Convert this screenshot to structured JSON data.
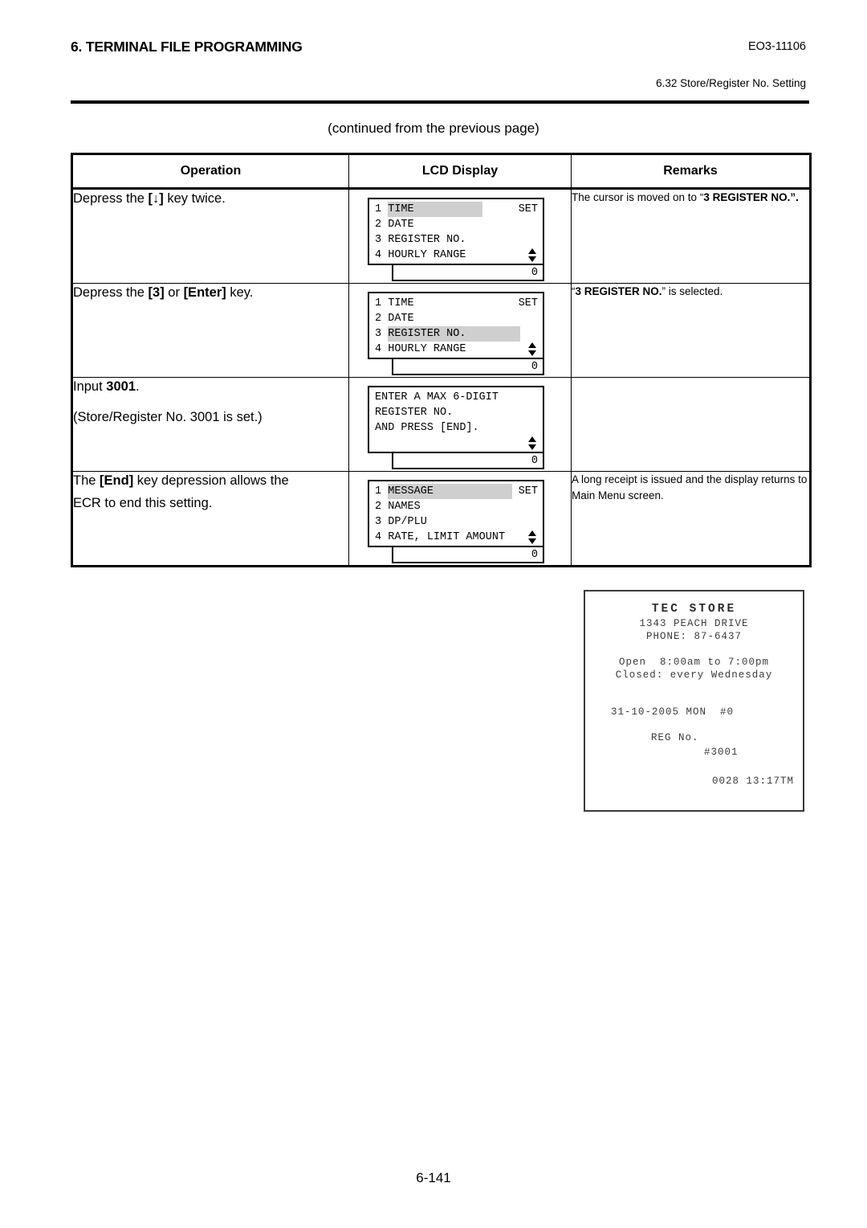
{
  "header": {
    "doc_title": "6. TERMINAL FILE PROGRAMMING",
    "doc_code": "EO3-11106",
    "section_ref": "6.32 Store/Register No. Setting"
  },
  "continued_note": "(continued from the previous page)",
  "table": {
    "columns": [
      "Operation",
      "LCD Display",
      "Remarks"
    ],
    "rows": [
      {
        "operation": {
          "prefix": "Depress the ",
          "key": "[↓]",
          "suffix": " key twice.",
          "line2": ""
        },
        "lcd": {
          "lines": [
            {
              "index": "1",
              "text": "TIME",
              "highlight": true,
              "hl_width": 118
            },
            {
              "index": "2",
              "text": "DATE",
              "highlight": false
            },
            {
              "index": "3",
              "text": "REGISTER NO.",
              "highlight": false
            },
            {
              "index": "4",
              "text": "HOURLY RANGE",
              "highlight": false
            }
          ],
          "set_label": "SET",
          "value": "0"
        },
        "remarks_plain_1": "The cursor is moved on to “",
        "remarks_bold": "3 REGISTER NO.",
        "remarks_plain_2": "”."
      },
      {
        "operation": {
          "prefix": "Depress the ",
          "key": "[3]",
          "middle": " or ",
          "key2": "[Enter]",
          "suffix": " key.",
          "line2": ""
        },
        "lcd": {
          "lines": [
            {
              "index": "1",
              "text": "TIME",
              "highlight": false
            },
            {
              "index": "2",
              "text": "DATE",
              "highlight": false
            },
            {
              "index": "3",
              "text": "REGISTER NO.",
              "highlight": true,
              "hl_width": 165
            },
            {
              "index": "4",
              "text": "HOURLY RANGE",
              "highlight": false
            }
          ],
          "set_label": "SET",
          "value": "0"
        },
        "remarks_plain_1": "“",
        "remarks_bold": "3 REGISTER NO.",
        "remarks_plain_2": "” is selected."
      },
      {
        "operation": {
          "prefix": "Input ",
          "key": "3001",
          "suffix": ".",
          "line2": "(Store/Register No. 3001 is set.)"
        },
        "lcd": {
          "text_lines": [
            "ENTER A MAX 6-DIGIT",
            "REGISTER NO.",
            "AND PRESS [END]."
          ],
          "value": "0"
        },
        "remarks_plain_1": "",
        "remarks_bold": "",
        "remarks_plain_2": ""
      },
      {
        "operation": {
          "prefix": "The ",
          "key": "[End]",
          "suffix": " key depression allows the",
          "line2": "ECR to end this setting."
        },
        "lcd": {
          "lines": [
            {
              "index": "1",
              "text": "MESSAGE",
              "highlight": true,
              "hl_width": 155
            },
            {
              "index": "2",
              "text": "NAMES",
              "highlight": false
            },
            {
              "index": "3",
              "text": "DP/PLU",
              "highlight": false
            },
            {
              "index": "4",
              "text": "RATE, LIMIT AMOUNT",
              "highlight": false
            }
          ],
          "set_label": "SET",
          "value": "0"
        },
        "remarks_plain_1": "A long receipt is issued and the display returns to Main Menu screen.",
        "remarks_bold": "",
        "remarks_plain_2": ""
      }
    ]
  },
  "receipt": {
    "store_name": "TEC STORE",
    "address": "1343 PEACH DRIVE",
    "phone": "PHONE: 87-6437",
    "hours_line1": "Open  8:00am to 7:00pm",
    "hours_line2": "Closed: every Wednesday",
    "date_line": "31-10-2005 MON  #0",
    "reg_label": "REG No.",
    "reg_number": "#3001",
    "footer_line": "0028 13:17TM"
  },
  "page_number": "6-141"
}
